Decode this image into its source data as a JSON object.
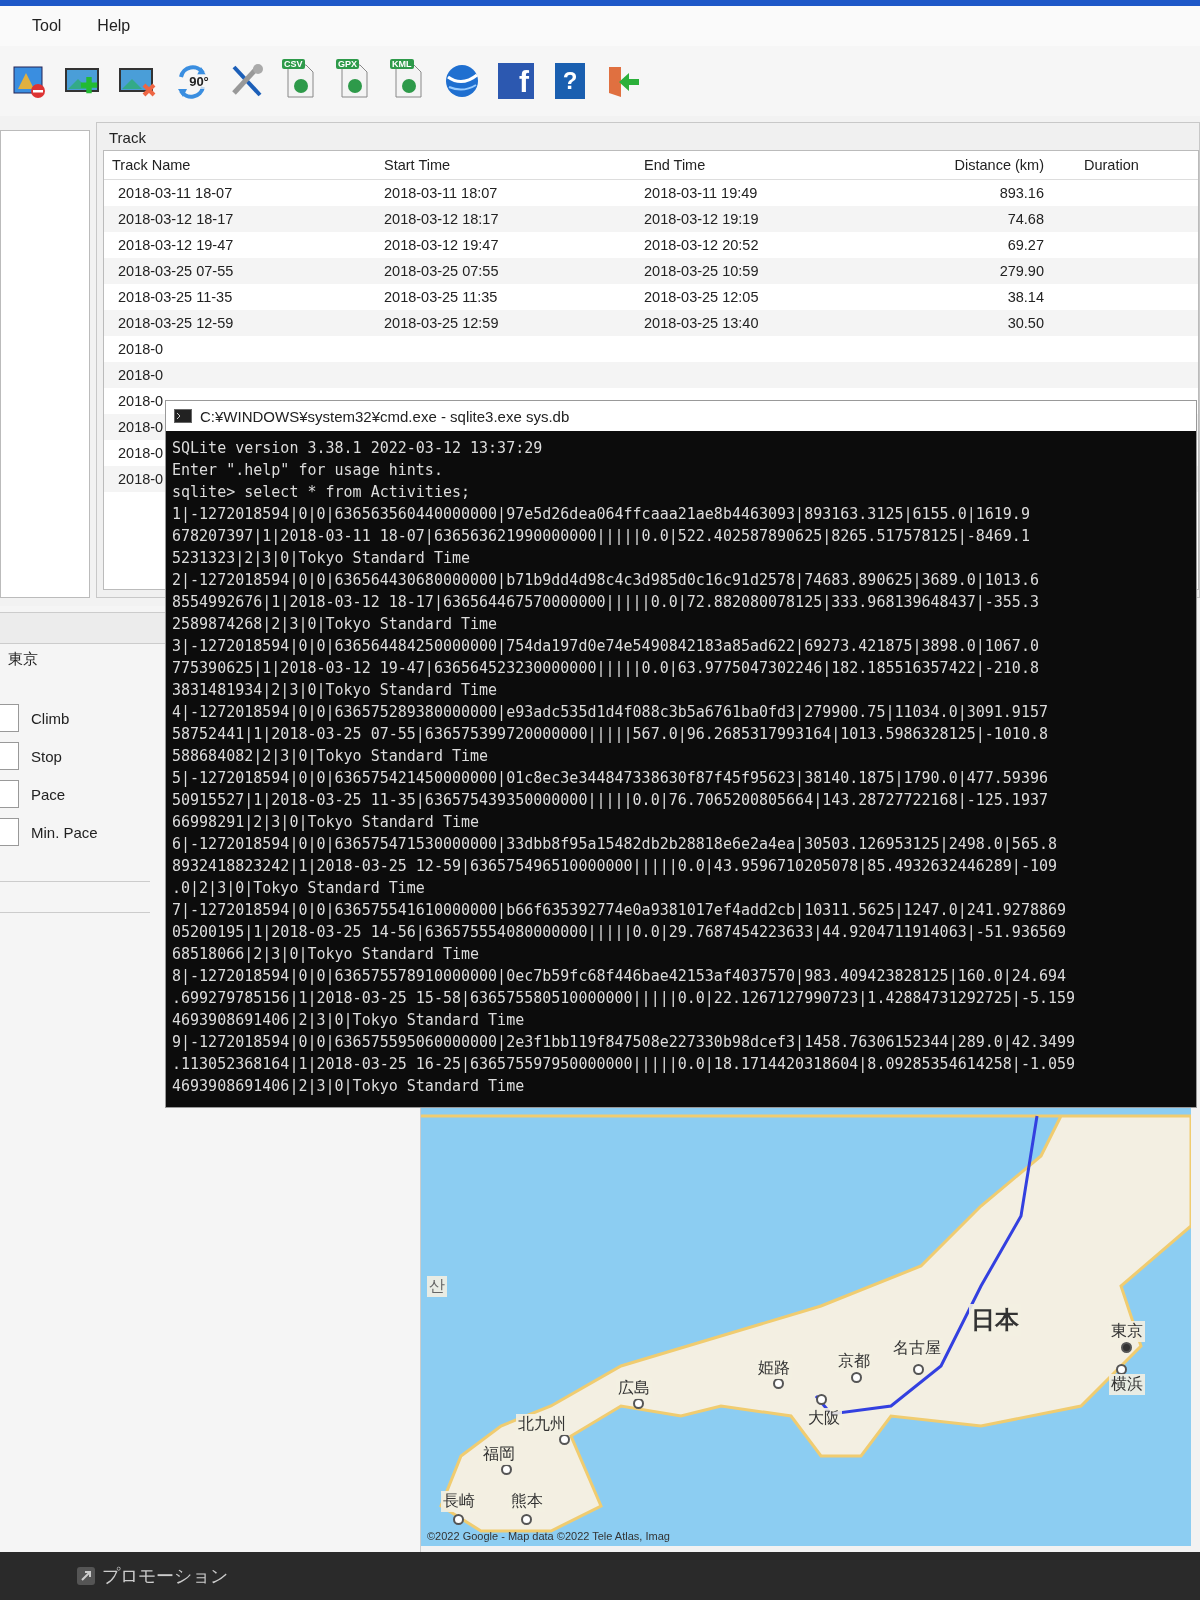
{
  "menu": [
    "Tool",
    "Help"
  ],
  "toolbar": [
    {
      "kind": "map-remove"
    },
    {
      "kind": "photo-add"
    },
    {
      "kind": "photo-remove"
    },
    {
      "kind": "rotate",
      "label": "90°"
    },
    {
      "kind": "tools"
    },
    {
      "kind": "file",
      "label": "CSV"
    },
    {
      "kind": "file",
      "label": "GPX"
    },
    {
      "kind": "file",
      "label": "KML"
    },
    {
      "kind": "globe"
    },
    {
      "kind": "facebook",
      "label": "f"
    },
    {
      "kind": "help",
      "label": "?"
    },
    {
      "kind": "exit"
    }
  ],
  "track_panel": {
    "title": "Track",
    "columns": [
      "Track Name",
      "Start Time",
      "End Time",
      "Distance (km)",
      "Duration"
    ],
    "rows": [
      [
        "2018-03-11 18-07",
        "2018-03-11 18:07",
        "2018-03-11 19:49",
        "893.16"
      ],
      [
        "2018-03-12 18-17",
        "2018-03-12 18:17",
        "2018-03-12 19:19",
        "74.68"
      ],
      [
        "2018-03-12 19-47",
        "2018-03-12 19:47",
        "2018-03-12 20:52",
        "69.27"
      ],
      [
        "2018-03-25 07-55",
        "2018-03-25 07:55",
        "2018-03-25 10:59",
        "279.90"
      ],
      [
        "2018-03-25 11-35",
        "2018-03-25 11:35",
        "2018-03-25 12:05",
        "38.14"
      ],
      [
        "2018-03-25 12-59",
        "2018-03-25 12:59",
        "2018-03-25 13:40",
        "30.50"
      ],
      [
        "2018-0"
      ],
      [
        "2018-0"
      ],
      [
        "2018-0"
      ],
      [
        "2018-0"
      ],
      [
        "2018-0"
      ],
      [
        "2018-0"
      ]
    ]
  },
  "console": {
    "title": "C:¥WINDOWS¥system32¥cmd.exe - sqlite3.exe  sys.db",
    "lines": [
      "SQLite version 3.38.1 2022-03-12 13:37:29",
      "Enter \".help\" for usage hints.",
      "sqlite> select * from Activities;",
      "1|-1272018594|0|0|636563560440000000|97e5d26dea064ffcaaa21ae8b4463093|893163.3125|6155.0|1619.9",
      "678207397|1|2018-03-11 18-07|636563621990000000|||||0.0|522.402587890625|8265.517578125|-8469.1",
      "5231323|2|3|0|Tokyo Standard Time",
      "2|-1272018594|0|0|636564430680000000|b71b9dd4d98c4c3d985d0c16c91d2578|74683.890625|3689.0|1013.6",
      "8554992676|1|2018-03-12 18-17|636564467570000000|||||0.0|72.882080078125|333.968139648437|-355.3",
      "2589874268|2|3|0|Tokyo Standard Time",
      "3|-1272018594|0|0|636564484250000000|754da197d0e74e5490842183a85ad622|69273.421875|3898.0|1067.0",
      "775390625|1|2018-03-12 19-47|636564523230000000|||||0.0|63.9775047302246|182.185516357422|-210.8",
      "3831481934|2|3|0|Tokyo Standard Time",
      "4|-1272018594|0|0|636575289380000000|e93adc535d1d4f088c3b5a6761ba0fd3|279900.75|11034.0|3091.9157",
      "58752441|1|2018-03-25 07-55|636575399720000000|||||567.0|96.2685317993164|1013.5986328125|-1010.8",
      "588684082|2|3|0|Tokyo Standard Time",
      "5|-1272018594|0|0|636575421450000000|01c8ec3e344847338630f87f45f95623|38140.1875|1790.0|477.59396",
      "50915527|1|2018-03-25 11-35|636575439350000000|||||0.0|76.7065200805664|143.28727722168|-125.1937",
      "66998291|2|3|0|Tokyo Standard Time",
      "6|-1272018594|0|0|636575471530000000|33dbb8f95a15482db2b28818e6e2a4ea|30503.126953125|2498.0|565.8",
      "8932418823242|1|2018-03-25 12-59|636575496510000000|||||0.0|43.9596710205078|85.4932632446289|-109",
      ".0|2|3|0|Tokyo Standard Time",
      "7|-1272018594|0|0|636575541610000000|b66f635392774e0a9381017ef4add2cb|10311.5625|1247.0|241.9278869",
      "05200195|1|2018-03-25 14-56|636575554080000000|||||0.0|29.7687454223633|44.9204711914063|-51.936569",
      "68518066|2|3|0|Tokyo Standard Time",
      "8|-1272018594|0|0|636575578910000000|0ec7b59fc68f446bae42153af4037570|983.409423828125|160.0|24.694",
      ".699279785156|1|2018-03-25 15-58|636575580510000000|||||0.0|22.1267127990723|1.42884731292725|-5.159",
      "4693908691406|2|3|0|Tokyo Standard Time",
      "9|-1272018594|0|0|636575595060000000|2e3f1bb119f847508e227330b98dcef3|1458.76306152344|289.0|42.3499",
      ".113052368164|1|2018-03-25 16-25|636575597950000000|||||0.0|18.1714420318604|8.09285354614258|-1.059",
      "4693908691406|2|3|0|Tokyo Standard Time"
    ]
  },
  "side_panel": {
    "location": "東京",
    "fields": [
      {
        "label": "Climb"
      },
      {
        "label": "Stop"
      },
      {
        "label": "Pace"
      },
      {
        "label": "Min. Pace"
      }
    ]
  },
  "map": {
    "labels": [
      {
        "text": "산",
        "kind": "partial"
      },
      {
        "text": "日本",
        "kind": "country"
      },
      {
        "text": "東京",
        "kind": "capital"
      },
      {
        "text": "横浜",
        "kind": "city"
      },
      {
        "text": "名古屋",
        "kind": "city"
      },
      {
        "text": "京都",
        "kind": "city"
      },
      {
        "text": "姫路",
        "kind": "city"
      },
      {
        "text": "大阪",
        "kind": "city"
      },
      {
        "text": "広島",
        "kind": "city"
      },
      {
        "text": "北九州",
        "kind": "city"
      },
      {
        "text": "福岡",
        "kind": "city"
      },
      {
        "text": "長崎",
        "kind": "city"
      },
      {
        "text": "熊本",
        "kind": "city"
      }
    ],
    "attribution": "©2022 Google - Map data ©2022 Tele Atlas, Imag"
  },
  "taskbar": {
    "items": [
      "プロモーション"
    ]
  }
}
